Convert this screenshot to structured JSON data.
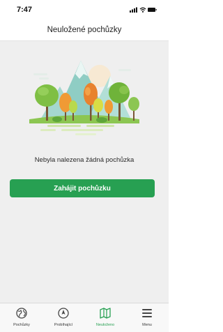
{
  "status_bar": {
    "time": "7:47",
    "icons": [
      "signal-icon",
      "wifi-icon",
      "battery-icon"
    ]
  },
  "header": {
    "title": "Neuložené pochůzky"
  },
  "main": {
    "empty_message": "Nebyla nalezena žádná pochůzka",
    "start_button_label": "Zahájit pochůzku",
    "illustration": "forest-landscape-illustration"
  },
  "tab_bar": {
    "active_index": 2,
    "items": [
      {
        "label": "Pochůzky",
        "icon": "globe-icon"
      },
      {
        "label": "Probíhající",
        "icon": "compass-icon"
      },
      {
        "label": "Neuloženo",
        "icon": "map-icon"
      },
      {
        "label": "Menu",
        "icon": "hamburger-menu-icon"
      }
    ]
  },
  "colors": {
    "accent": "#27a052",
    "background": "#efefef",
    "header_background": "#ffffff",
    "tab_bar_background": "#f8f8f8"
  }
}
